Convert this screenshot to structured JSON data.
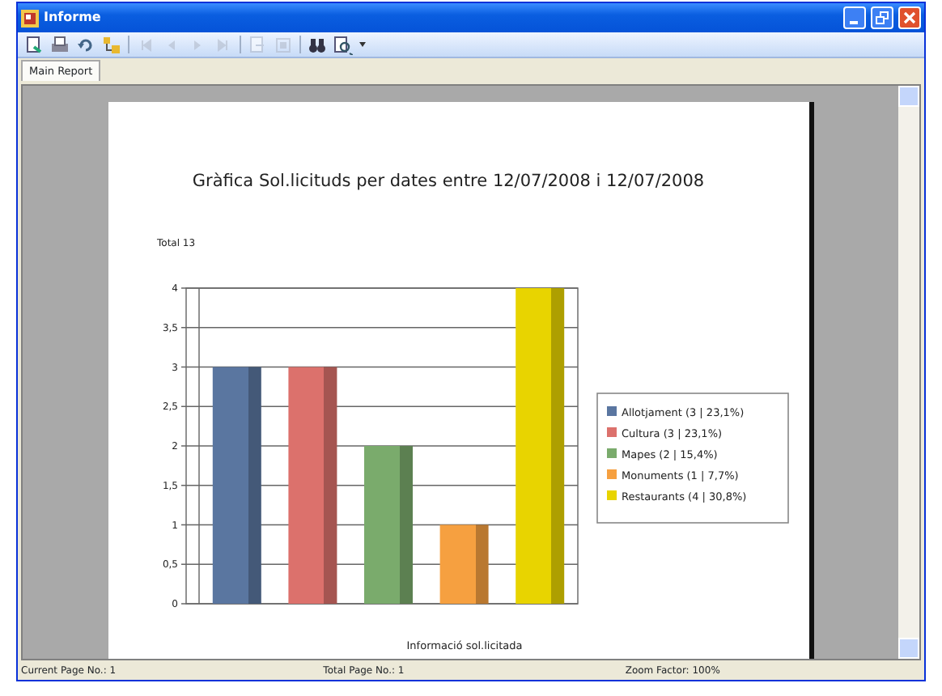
{
  "window": {
    "title": "Informe"
  },
  "toolbar": [
    {
      "kind": "export",
      "disabled": false
    },
    {
      "kind": "print",
      "disabled": false
    },
    {
      "kind": "refresh",
      "disabled": false
    },
    {
      "kind": "tree",
      "disabled": false
    },
    {
      "kind": "first",
      "disabled": true
    },
    {
      "kind": "prev",
      "disabled": true
    },
    {
      "kind": "next",
      "disabled": true
    },
    {
      "kind": "last",
      "disabled": true
    },
    {
      "kind": "goto",
      "disabled": true
    },
    {
      "kind": "stop",
      "disabled": true
    },
    {
      "kind": "find",
      "disabled": false
    },
    {
      "kind": "zoom",
      "disabled": false
    }
  ],
  "tabs": [
    {
      "label": "Main Report",
      "selected": true
    }
  ],
  "report": {
    "total": "Total 13",
    "chart_data": {
      "type": "bar",
      "title": "Gràfica Sol.licituds per dates entre 12/07/2008 i 12/07/2008",
      "xlabel": "Informació sol.licitada",
      "ylim": [
        0,
        4
      ],
      "legend": true,
      "yticks": [
        {
          "value": 0,
          "label": "0"
        },
        {
          "value": 0.5,
          "label": "0,5"
        },
        {
          "value": 1,
          "label": "1"
        },
        {
          "value": 1.5,
          "label": "1,5"
        },
        {
          "value": 2,
          "label": "2"
        },
        {
          "value": 2.5,
          "label": "2,5"
        },
        {
          "value": 3,
          "label": "3"
        },
        {
          "value": 3.5,
          "label": "3,5"
        },
        {
          "value": 4,
          "label": "4"
        }
      ],
      "series": [
        {
          "name": "Allotjament (3 | 23,1%)",
          "color": "#5a76a0",
          "values": [
            3,
            null,
            null,
            null,
            null
          ]
        },
        {
          "name": "Cultura (3 | 23,1%)",
          "color": "#dc716c",
          "values": [
            null,
            3,
            null,
            null,
            null
          ]
        },
        {
          "name": "Mapes (2 | 15,4%)",
          "color": "#7aab6c",
          "values": [
            null,
            null,
            2,
            null,
            null
          ]
        },
        {
          "name": "Monuments (1 | 7,7%)",
          "color": "#f6a040",
          "values": [
            null,
            null,
            null,
            1,
            null
          ]
        },
        {
          "name": "Restaurants (4 | 30,8%)",
          "color": "#e8d400",
          "values": [
            null,
            null,
            null,
            null,
            4
          ]
        }
      ]
    }
  },
  "status_bar": [
    "Current Page No.: 1",
    "Total Page No.: 1",
    "Zoom Factor: 100%"
  ]
}
